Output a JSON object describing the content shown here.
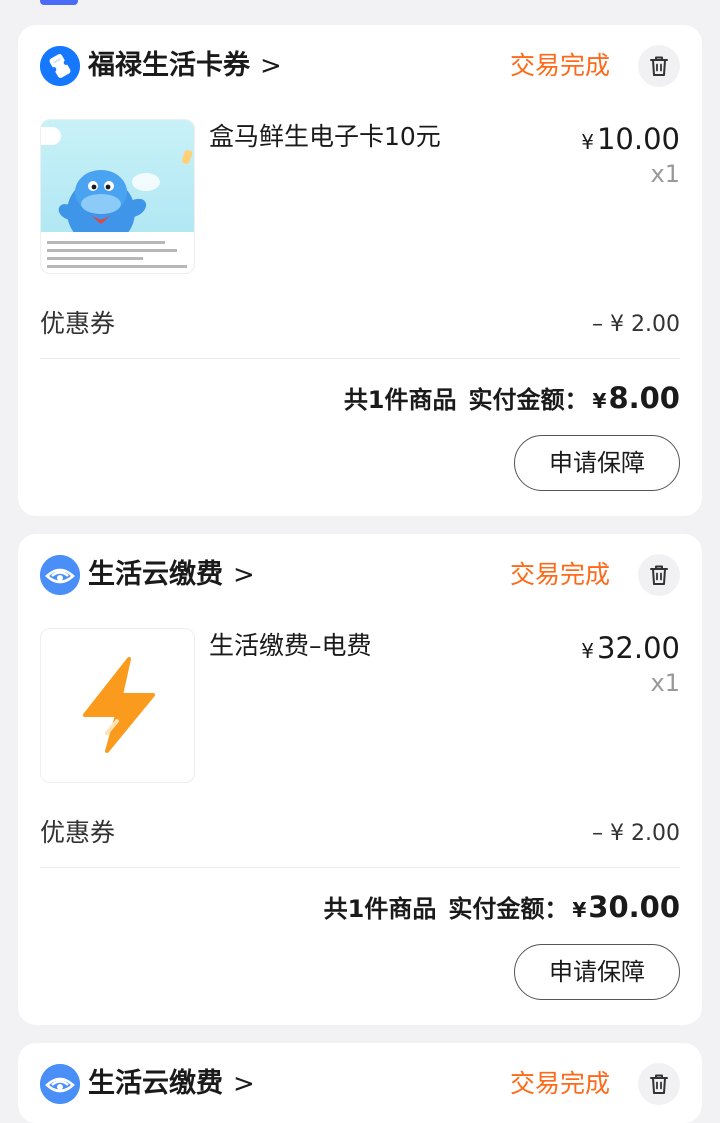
{
  "colors": {
    "accent": "#1677ff",
    "status_orange": "#ff6a1a",
    "cloud_icon_blue": "#4a8ff7",
    "lightning_orange": "#fa9b1e"
  },
  "orders": [
    {
      "shop_name": "福禄生活卡券",
      "shop_icon": "ticket-icon",
      "status": "交易完成",
      "product_name": "盒马鲜生电子卡10元",
      "product_image": "hippo-mascot-card-image",
      "price_symbol": "¥",
      "price": "10.00",
      "quantity": "x1",
      "coupon_label": "优惠券",
      "coupon_value": "– ¥ 2.00",
      "count_text": "共1件商品",
      "paid_label": "实付金额：",
      "paid_symbol": "¥",
      "paid_amount": "8.00",
      "protect_button": "申请保障"
    },
    {
      "shop_name": "生活云缴费",
      "shop_icon": "cloud-eye-icon",
      "status": "交易完成",
      "product_name": "生活缴费–电费",
      "product_image": "lightning-icon",
      "price_symbol": "¥",
      "price": "32.00",
      "quantity": "x1",
      "coupon_label": "优惠券",
      "coupon_value": "– ¥ 2.00",
      "count_text": "共1件商品",
      "paid_label": "实付金额：",
      "paid_symbol": "¥",
      "paid_amount": "30.00",
      "protect_button": "申请保障"
    },
    {
      "shop_name": "生活云缴费",
      "shop_icon": "cloud-eye-icon",
      "status": "交易完成"
    }
  ]
}
